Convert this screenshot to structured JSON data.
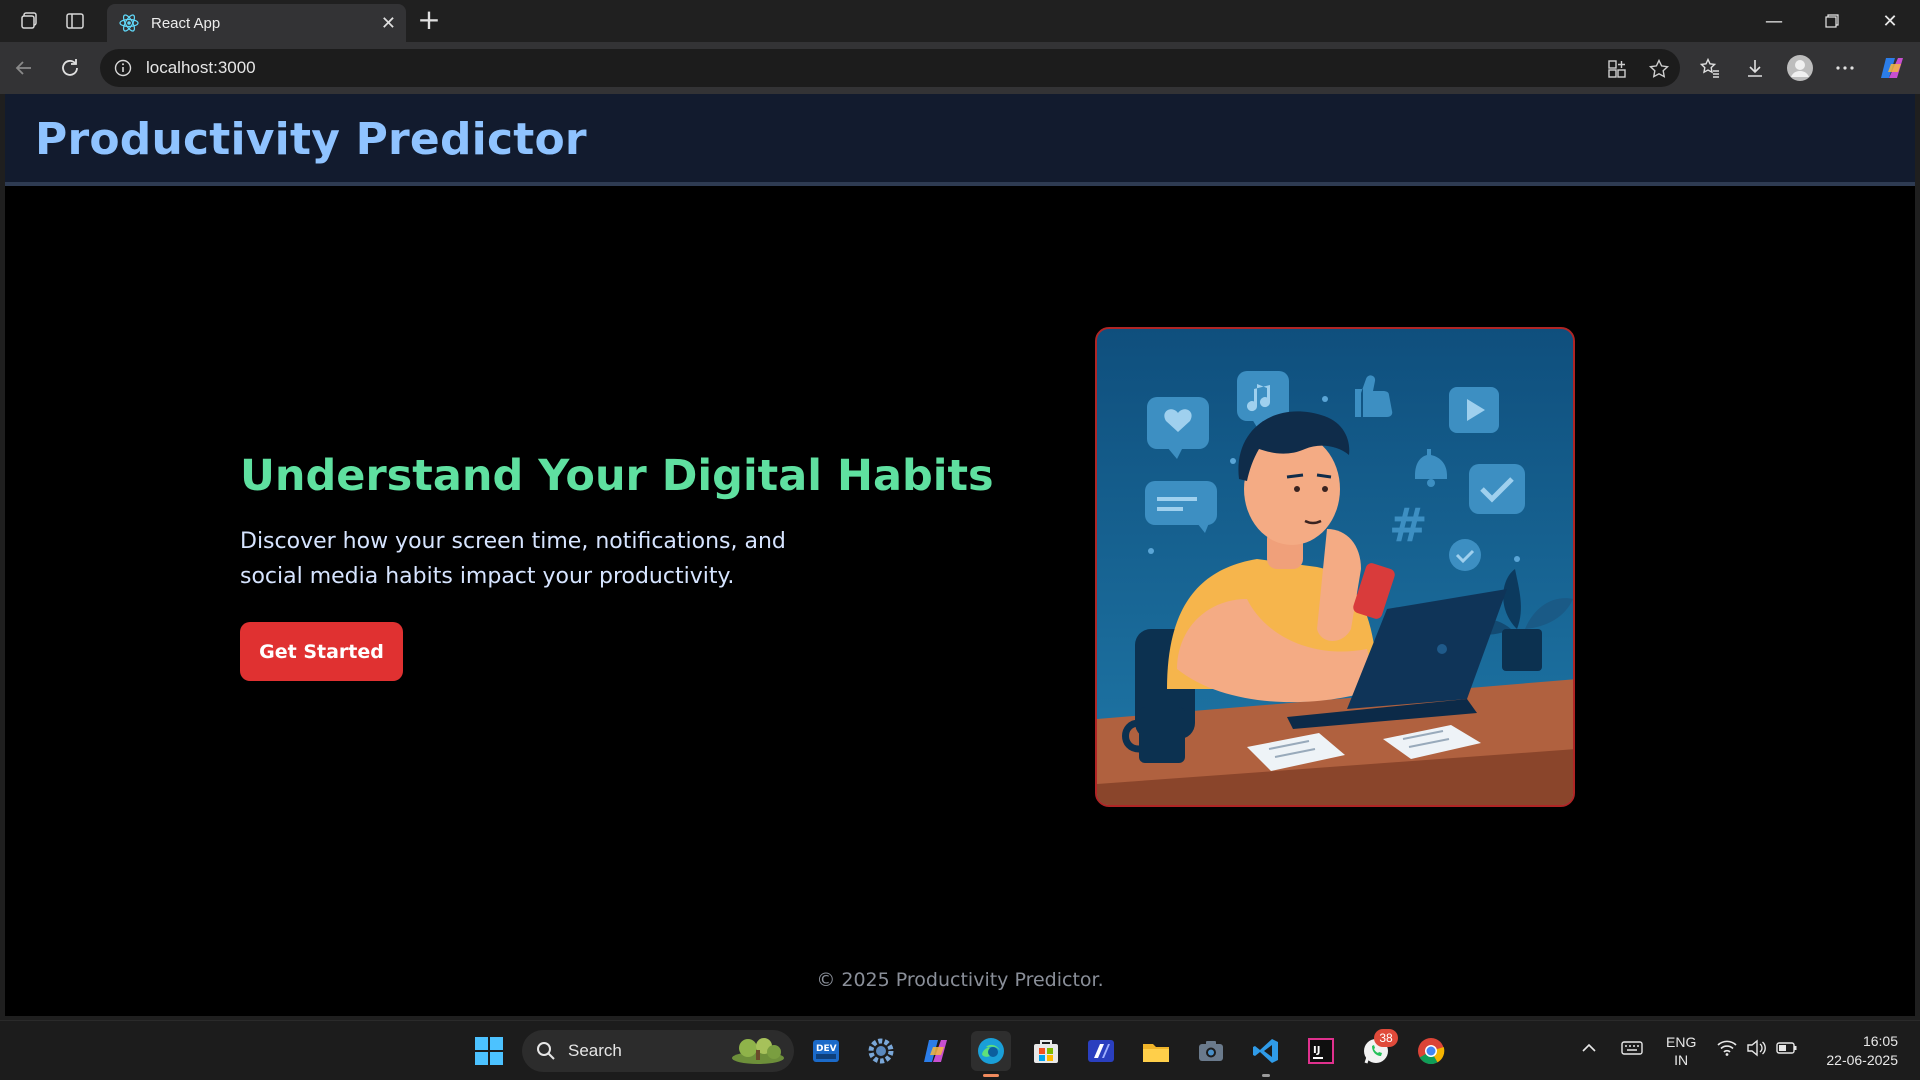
{
  "browser": {
    "tab_title": "React App",
    "url": "localhost:3000"
  },
  "app": {
    "title": "Productivity Predictor",
    "hero": {
      "heading": "Understand Your Digital Habits",
      "description": "Discover how your screen time, notifications, and social media habits impact your productivity.",
      "cta_label": "Get Started"
    },
    "footer": "© 2025 Productivity Predictor."
  },
  "taskbar": {
    "search_label": "Search",
    "notification_count": "38",
    "language_top": "ENG",
    "language_bottom": "IN",
    "time": "16:05",
    "date": "22-06-2025"
  },
  "colors": {
    "header_bg": "#121b2e",
    "title": "#8fc3ff",
    "heading": "#5fe0a0",
    "cta": "#e03131"
  }
}
